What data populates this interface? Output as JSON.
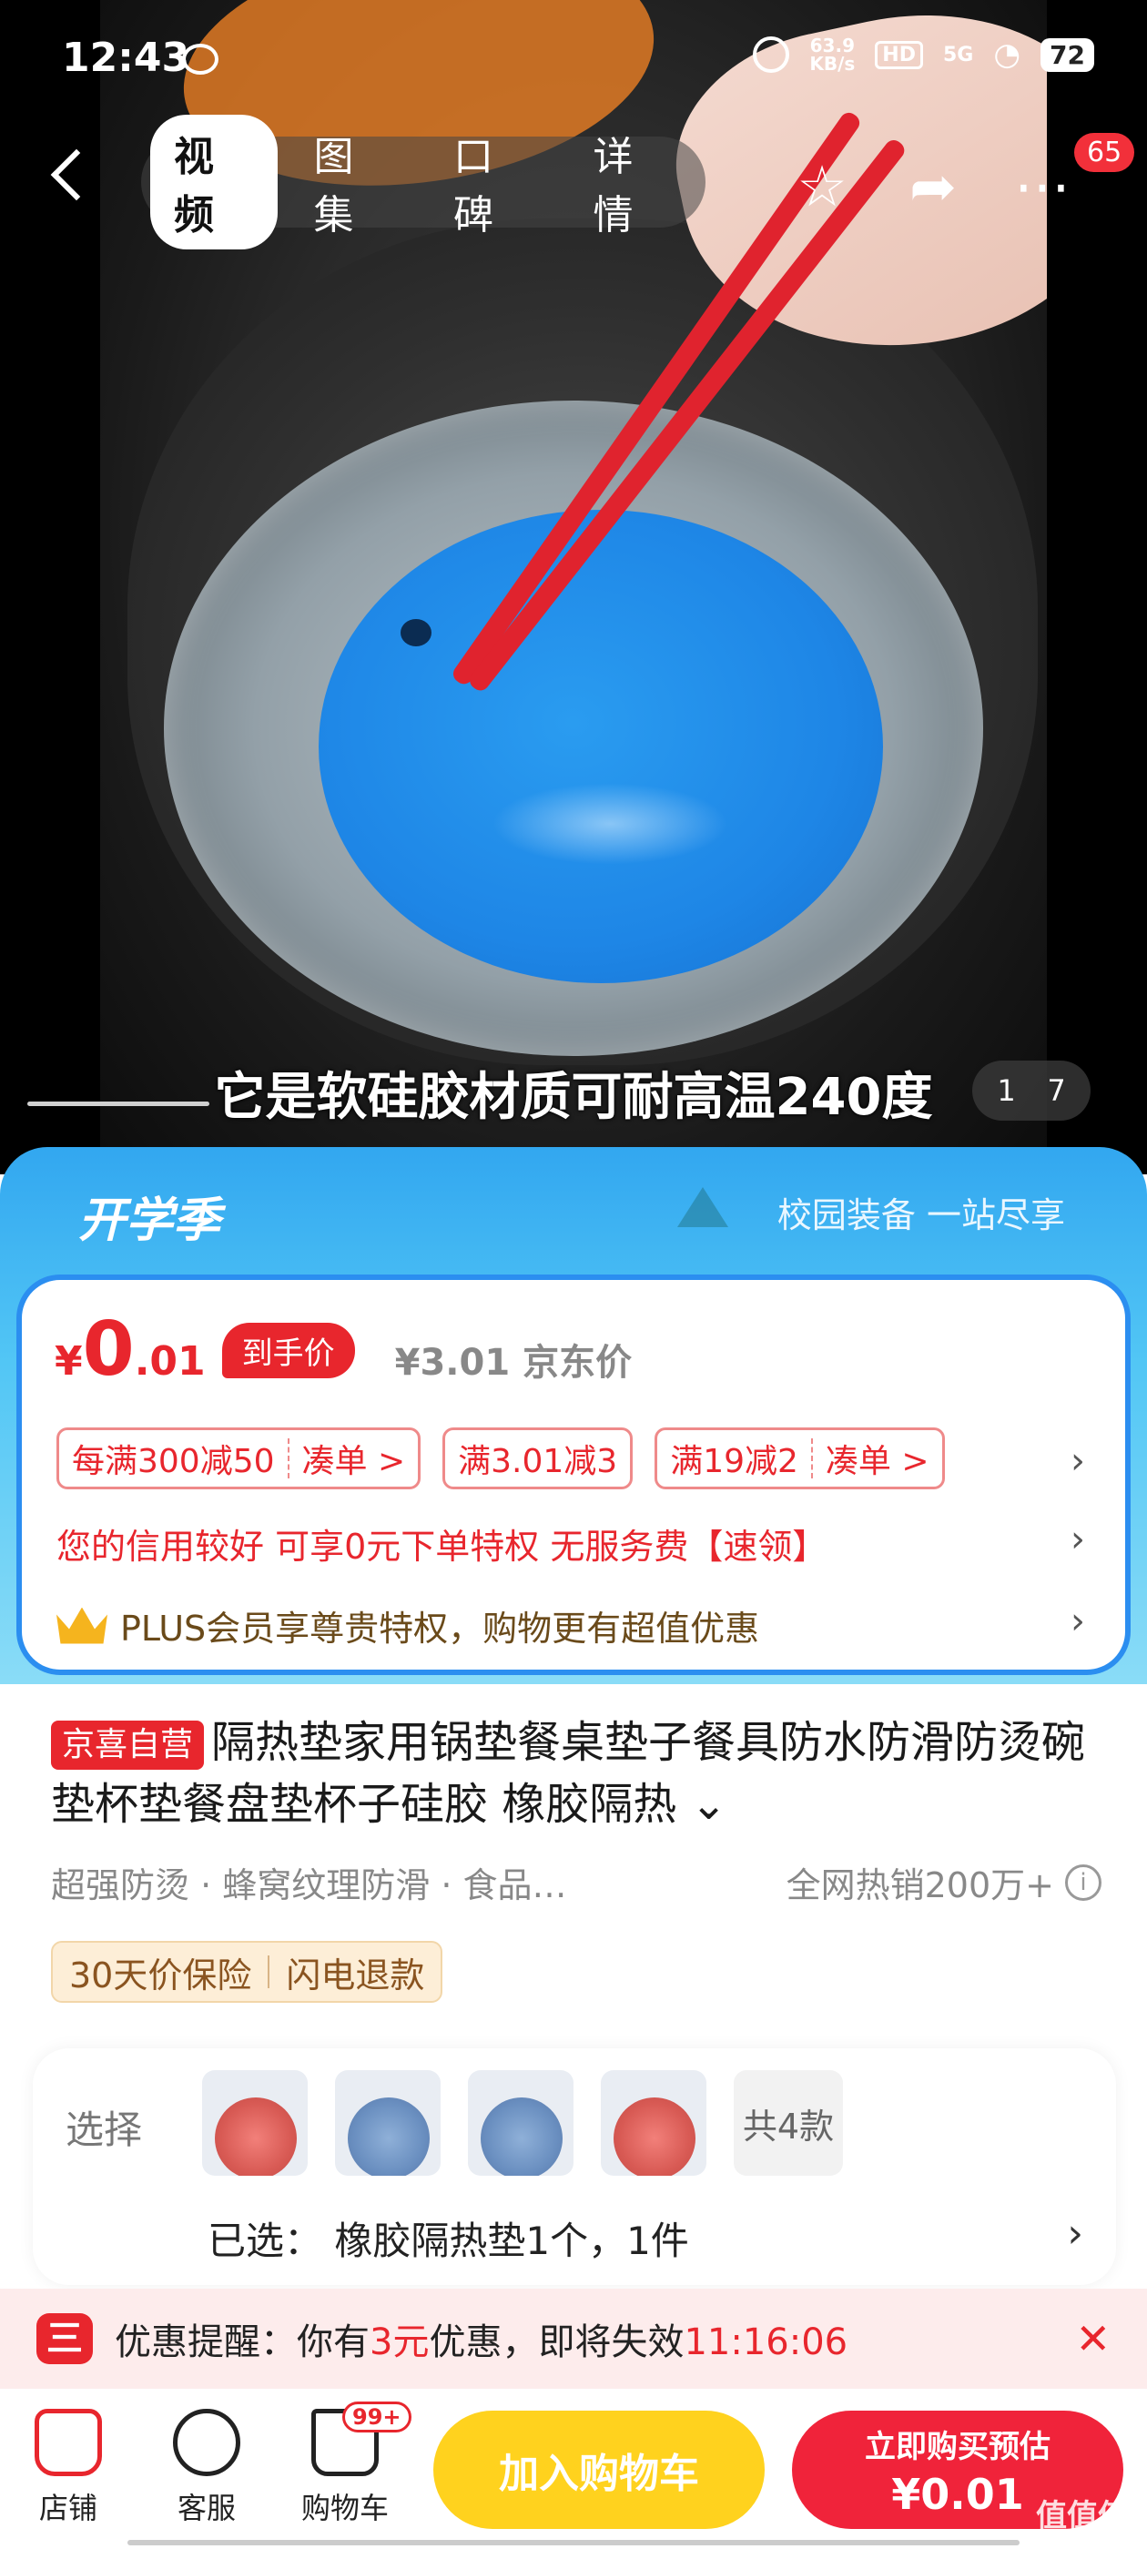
{
  "status_bar": {
    "time": "12:43",
    "net_speed_value": "63.9",
    "net_speed_unit": "KB/s",
    "hd": "HD",
    "signal": "5G",
    "battery": "72"
  },
  "nav": {
    "tabs": [
      {
        "label": "视频",
        "active": true
      },
      {
        "label": "图集",
        "active": false
      },
      {
        "label": "口碑",
        "active": false
      },
      {
        "label": "详情",
        "active": false
      }
    ],
    "more_badge": "65",
    "icons": [
      "back-icon",
      "star-icon",
      "share-icon",
      "more-icon"
    ]
  },
  "video": {
    "subtitle": "它是软硅胶材质可耐高温240度",
    "counter_current": "1",
    "counter_total": "7"
  },
  "promo": {
    "title": "开学季",
    "slogan": "校园装备 一站尽享"
  },
  "price": {
    "currency": "¥",
    "integer": "0",
    "decimal": ".01",
    "tag": "到手价",
    "jd_price": "¥3.01 京东价",
    "coupons": [
      {
        "text": "每满300减50",
        "action": "凑单 >"
      },
      {
        "text": "满3.01减3",
        "action": ""
      },
      {
        "text": "满19减2",
        "action": "凑单 >"
      }
    ],
    "credit_text": "您的信用较好 可享0元下单特权 无服务费【速领】",
    "plus_text": "PLUS会员享尊贵特权，购物更有超值优惠"
  },
  "product": {
    "badge": "京喜自营",
    "title": "隔热垫家用锅垫餐桌垫子餐具防水防滑防烫碗垫杯垫餐盘垫杯子硅胶 橡胶隔热 ⌄",
    "features": "超强防烫  · 蜂窝纹理防滑  · 食品…",
    "hot": "全网热销200万+",
    "guarantees": [
      "30天价保险",
      "闪电退款"
    ]
  },
  "selection": {
    "label": "选择",
    "count": "共4款",
    "selected": "已选：  橡胶隔热垫1个，1件"
  },
  "reminder": {
    "prefix": "优惠提醒：你有",
    "amount": "3元",
    "middle": "优惠，即将失效",
    "countdown": "11:16:06"
  },
  "bottom": {
    "store": "店铺",
    "service": "客服",
    "cart": "购物车",
    "cart_badge": "99+",
    "add_cart": "加入购物车",
    "buy_line1": "立即购买预估",
    "buy_line2": "¥0.01"
  },
  "watermark": "值值值",
  "colors": {
    "accent_red": "#e8262d",
    "promo_blue": "#32a7f0",
    "cart_yellow": "#ffd21e"
  }
}
